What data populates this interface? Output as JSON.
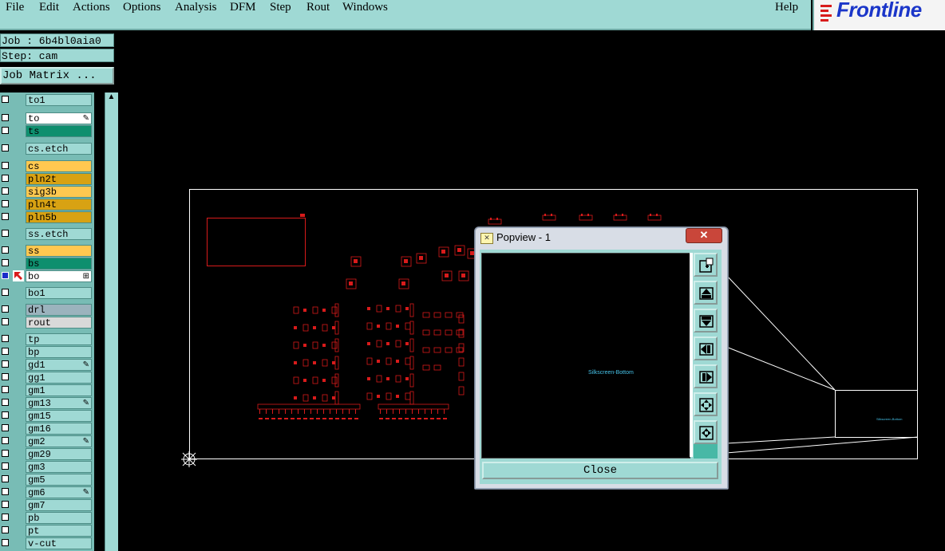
{
  "menubar": {
    "items": [
      "File",
      "Edit",
      "Actions",
      "Options",
      "Analysis",
      "DFM",
      "Step",
      "Rout",
      "Windows"
    ],
    "help": "Help"
  },
  "logo": {
    "text": "Frontline"
  },
  "job": {
    "job_label": "Job : 6b4bl0aia0",
    "step_label": "Step: cam",
    "matrix_button": "Job Matrix ..."
  },
  "layers": [
    {
      "name": "to1",
      "color": "#9fd9d4"
    },
    {
      "name": "to",
      "color": "#ffffff",
      "tag": "edit-icon"
    },
    {
      "name": "ts",
      "color": "#0e8f6e"
    },
    {
      "name": "cs.etch",
      "color": "#9fd9d4"
    },
    {
      "name": "cs",
      "color": "#ffc850"
    },
    {
      "name": "pln2t",
      "color": "#d8a213"
    },
    {
      "name": "sig3b",
      "color": "#ffc850"
    },
    {
      "name": "pln4t",
      "color": "#d8a213"
    },
    {
      "name": "pln5b",
      "color": "#d8a213"
    },
    {
      "name": "ss.etch",
      "color": "#9fd9d4"
    },
    {
      "name": "ss",
      "color": "#ffc850"
    },
    {
      "name": "bs",
      "color": "#0e8f6e"
    },
    {
      "name": "bo",
      "color": "#ffffff",
      "active": true,
      "tag": "grid-icon"
    },
    {
      "name": "bo1",
      "color": "#9fd9d4"
    },
    {
      "name": "drl",
      "color": "#9bb3bd"
    },
    {
      "name": "rout",
      "color": "#d9d9d9"
    },
    {
      "name": "tp",
      "color": "#9fd9d4"
    },
    {
      "name": "bp",
      "color": "#9fd9d4"
    },
    {
      "name": "gd1",
      "color": "#9fd9d4",
      "tag": "edit-icon"
    },
    {
      "name": "gg1",
      "color": "#9fd9d4"
    },
    {
      "name": "gm1",
      "color": "#9fd9d4"
    },
    {
      "name": "gm13",
      "color": "#9fd9d4",
      "tag": "edit-icon"
    },
    {
      "name": "gm15",
      "color": "#9fd9d4"
    },
    {
      "name": "gm16",
      "color": "#9fd9d4"
    },
    {
      "name": "gm2",
      "color": "#9fd9d4",
      "tag": "edit-icon"
    },
    {
      "name": "gm29",
      "color": "#9fd9d4"
    },
    {
      "name": "gm3",
      "color": "#9fd9d4"
    },
    {
      "name": "gm5",
      "color": "#9fd9d4"
    },
    {
      "name": "gm6",
      "color": "#9fd9d4",
      "tag": "edit-icon"
    },
    {
      "name": "gm7",
      "color": "#9fd9d4"
    },
    {
      "name": "pb",
      "color": "#9fd9d4"
    },
    {
      "name": "pt",
      "color": "#9fd9d4"
    },
    {
      "name": "v-cut",
      "color": "#9fd9d4"
    }
  ],
  "popview": {
    "title": "Popview - 1",
    "canvas_label": "Silkscreen-Bottom",
    "close_label": "Close",
    "tools": [
      "zoom-in-icon",
      "pan-up-icon",
      "pan-down-icon",
      "pan-left-icon",
      "pan-right-icon",
      "zoom-fit-icon",
      "zoom-out-icon"
    ]
  },
  "colors": {
    "panel": "#9fd9d4",
    "copper": "#d81b1b",
    "outline": "#ffffff",
    "popview_text": "#46c2e8"
  }
}
